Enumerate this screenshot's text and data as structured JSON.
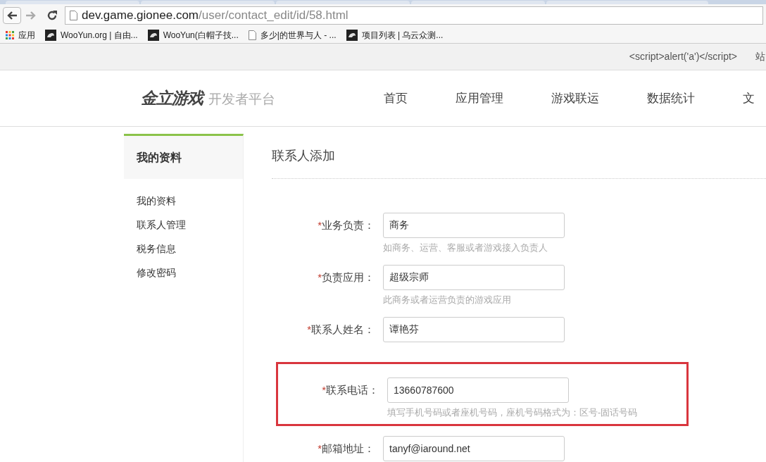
{
  "browser": {
    "url_host": "dev.game.gionee.com",
    "url_path": "/user/contact_edit/id/58.html",
    "bookmarks": [
      {
        "kind": "apps",
        "label": "应用"
      },
      {
        "kind": "site",
        "label": "WooYun.org | 自由..."
      },
      {
        "kind": "site",
        "label": "WooYun(白帽子技..."
      },
      {
        "kind": "page",
        "label": "多少|的世界与人 - ..."
      },
      {
        "kind": "site",
        "label": "项目列表 | 乌云众测..."
      }
    ]
  },
  "top_bar": {
    "links": [
      "<script>alert('a')</script>",
      "站"
    ]
  },
  "header": {
    "logo": "金立游戏",
    "logo_subtitle": "开发者平台",
    "nav": [
      "首页",
      "应用管理",
      "游戏联运",
      "数据统计",
      "文"
    ]
  },
  "sidebar": {
    "title": "我的资料",
    "items": [
      "我的资料",
      "联系人管理",
      "税务信息",
      "修改密码"
    ]
  },
  "form": {
    "title": "联系人添加",
    "fields": [
      {
        "label": "业务负责：",
        "required_mark": "*",
        "value": "商务",
        "hint": "如商务、运营、客服或者游戏接入负责人",
        "highlighted": false
      },
      {
        "label": "负责应用：",
        "required_mark": "*",
        "value": "超级宗师",
        "hint": "此商务或者运营负责的游戏应用",
        "highlighted": false
      },
      {
        "label": "联系人姓名：",
        "required_mark": "*",
        "value": "谭艳芬",
        "highlighted": false
      },
      {
        "label": "联系电话：",
        "required_mark": "*",
        "value": "13660787600",
        "hint": "填写手机号码或者座机号码，座机号码格式为：区号-固话号码",
        "highlighted": true
      },
      {
        "label": "邮箱地址：",
        "required_mark": "*",
        "value": "tanyf@iaround.net",
        "highlighted": false
      }
    ]
  }
}
